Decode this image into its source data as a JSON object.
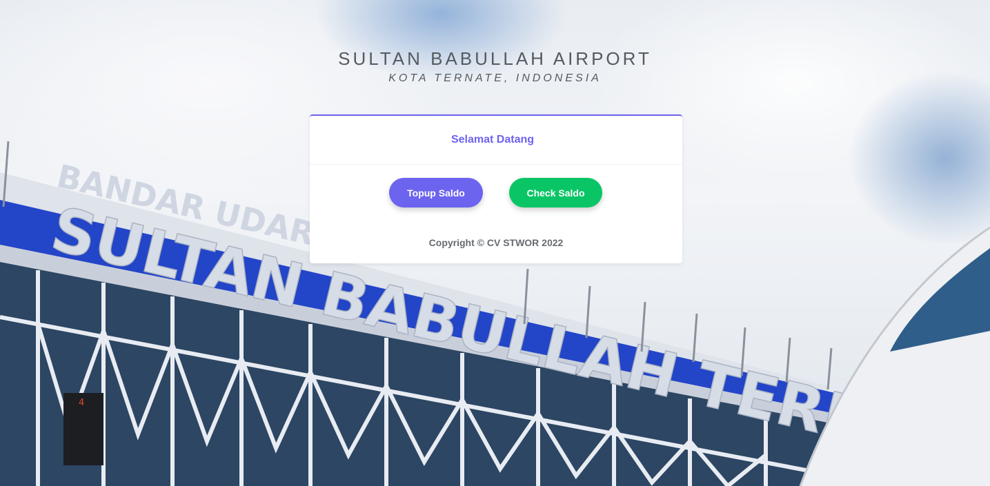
{
  "header": {
    "title": "SULTAN BABULLAH AIRPORT",
    "subtitle": "KOTA TERNATE, INDONESIA"
  },
  "card": {
    "heading": "Selamat Datang",
    "buttons": {
      "topup_label": "Topup Saldo",
      "check_label": "Check Saldo"
    },
    "copyright": "Copyright © CV STWOR 2022"
  },
  "background": {
    "sign_line1": "BANDAR UDARA",
    "sign_line2": "SULTAN BABULLAH TERNATE",
    "gate_number": "4"
  },
  "colors": {
    "accent": "#6c63ef",
    "success": "#0ac565",
    "text": "#555a60",
    "facade_blue": "#2345c8"
  }
}
